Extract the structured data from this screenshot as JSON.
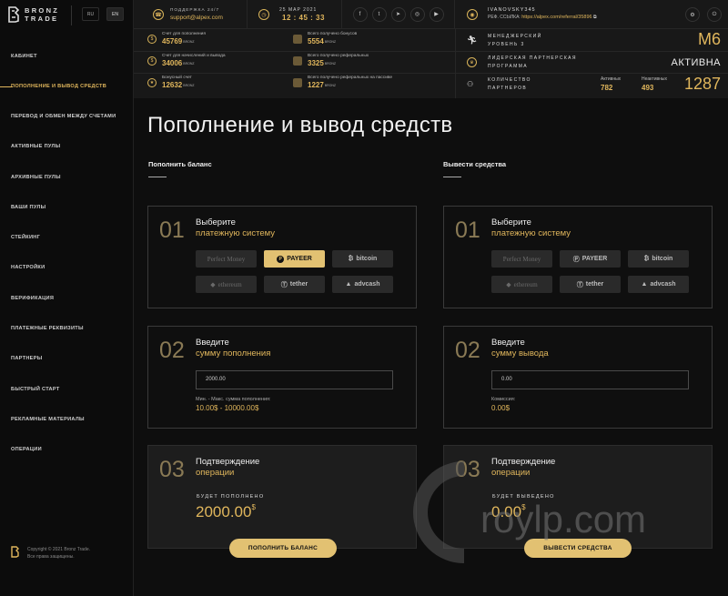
{
  "brand": {
    "line1": "BRONZ",
    "line2": "TRADE"
  },
  "languages": [
    "RU",
    "EN"
  ],
  "nav": [
    {
      "label": "КАБИНЕТ",
      "active": false
    },
    {
      "label": "ПОПОЛНЕНИЕ И ВЫВОД СРЕДСТВ",
      "active": true
    },
    {
      "label": "ПЕРЕВОД И ОБМЕН МЕЖДУ СЧЕТАМИ",
      "active": false
    },
    {
      "label": "АКТИВНЫЕ ПУЛЫ",
      "active": false
    },
    {
      "label": "АРХИВНЫЕ ПУЛЫ",
      "active": false
    },
    {
      "label": "ВАШИ ПУЛЫ",
      "active": false
    },
    {
      "label": "СТЕЙКИНГ",
      "active": false
    },
    {
      "label": "НАСТРОЙКИ",
      "active": false
    },
    {
      "label": "ВЕРИФИКАЦИЯ",
      "active": false
    },
    {
      "label": "ПЛАТЕЖНЫЕ РЕКВИЗИТЫ",
      "active": false
    },
    {
      "label": "ПАРТНЕРЫ",
      "active": false
    },
    {
      "label": "БЫСТРЫЙ СТАРТ",
      "active": false
    },
    {
      "label": "РЕКЛАМНЫЕ МАТЕРИАЛЫ",
      "active": false
    },
    {
      "label": "ОПЕРАЦИИ",
      "active": false
    }
  ],
  "footer": {
    "copyright": "Copyright © 2021 Bronz Trade.",
    "rights": "Все права защищены."
  },
  "support": {
    "label": "ПОДДЕРЖКА 24/7",
    "email": "support@alpex.com"
  },
  "clock": {
    "date": "25 МАР 2021",
    "time": "12 : 45 : 33"
  },
  "socials": [
    "facebook-icon",
    "twitter-icon",
    "telegram-icon",
    "instagram-icon",
    "youtube-icon"
  ],
  "stats_left": [
    {
      "label": "Счет для пополнения",
      "value": "45769",
      "unit": "BRONZ",
      "icon": "wallet-icon"
    },
    {
      "label": "Счет для начислений и вывода",
      "value": "34006",
      "unit": "BRONZ",
      "icon": "coin-icon"
    },
    {
      "label": "Бонусный счет",
      "value": "12632",
      "unit": "BRONZ",
      "icon": "bonus-icon"
    }
  ],
  "stats_right": [
    {
      "label": "Всего получено бонусов",
      "value": "5554",
      "unit": "BRONZ"
    },
    {
      "label": "Всего получено реферальных",
      "value": "3325",
      "unit": "BRONZ"
    },
    {
      "label": "Всего получено реферальных на пассиве",
      "value": "1227",
      "unit": "BRONZ"
    }
  ],
  "user": {
    "name": "IVANOVSKY345",
    "ref_label": "РЕФ. ССЫЛКА:",
    "ref_link": "https://alpex.com/referral/35896"
  },
  "manager": {
    "label_line1": "МЕНЕДЖЕРСКИЙ",
    "label_line2": "УРОВЕНЬ 3",
    "value": "M6"
  },
  "leader": {
    "label_line1": "ЛИДЕРСКАЯ ПАРТНЕРСКАЯ",
    "label_line2": "ПРОГРАММА",
    "value": "АКТИВНА"
  },
  "partners": {
    "label_line1": "КОЛИЧЕСТВО",
    "label_line2": "ПАРТНЕРОВ",
    "active_label": "Активных",
    "active": "782",
    "inactive_label": "Неактивных",
    "inactive": "493",
    "total": "1287"
  },
  "page_title": "Пополнение и вывод средств",
  "deposit": {
    "title": "Пополнить баланс",
    "step1": {
      "num": "01",
      "title": "Выберите",
      "sub": "платежную систему"
    },
    "step2": {
      "num": "02",
      "title": "Введите",
      "sub": "сумму пополнения",
      "input_value": "2000.00",
      "note": "Мин. - Макс. сумма пополнения:",
      "note_value": "10.00$ - 10000.00$"
    },
    "step3": {
      "num": "03",
      "title": "Подтверждение",
      "sub": "операции",
      "sum_label": "БУДЕТ ПОПОЛНЕНО",
      "sum_value": "2000.00",
      "currency": "$"
    },
    "button": "ПОПОЛНИТЬ БАЛАНС"
  },
  "withdraw": {
    "title": "Вывести средства",
    "step1": {
      "num": "01",
      "title": "Выберите",
      "sub": "платежную систему"
    },
    "step2": {
      "num": "02",
      "title": "Введите",
      "sub": "сумму вывода",
      "input_value": "0.00",
      "note": "Комиссия:",
      "note_value": "0.00$"
    },
    "step3": {
      "num": "03",
      "title": "Подтверждение",
      "sub": "операции",
      "sum_label": "БУДЕТ ВЫВЕДЕНО",
      "sum_value": "0.00",
      "currency": "$"
    },
    "button": "ВЫВЕСТИ СРЕДСТВА"
  },
  "payment_systems": [
    {
      "name": "Perfect Money",
      "sel_deposit": false
    },
    {
      "name": "PAYEER",
      "sel_deposit": true
    },
    {
      "name": "bitcoin",
      "sel_deposit": false
    },
    {
      "name": "ethereum",
      "sel_deposit": false
    },
    {
      "name": "tether",
      "sel_deposit": false
    },
    {
      "name": "advcash",
      "sel_deposit": false
    }
  ],
  "watermark": "roylp.com",
  "colors": {
    "accent": "#e0b65c",
    "button": "#e2c172",
    "bg": "#0e0e0e",
    "header": "#181818"
  }
}
